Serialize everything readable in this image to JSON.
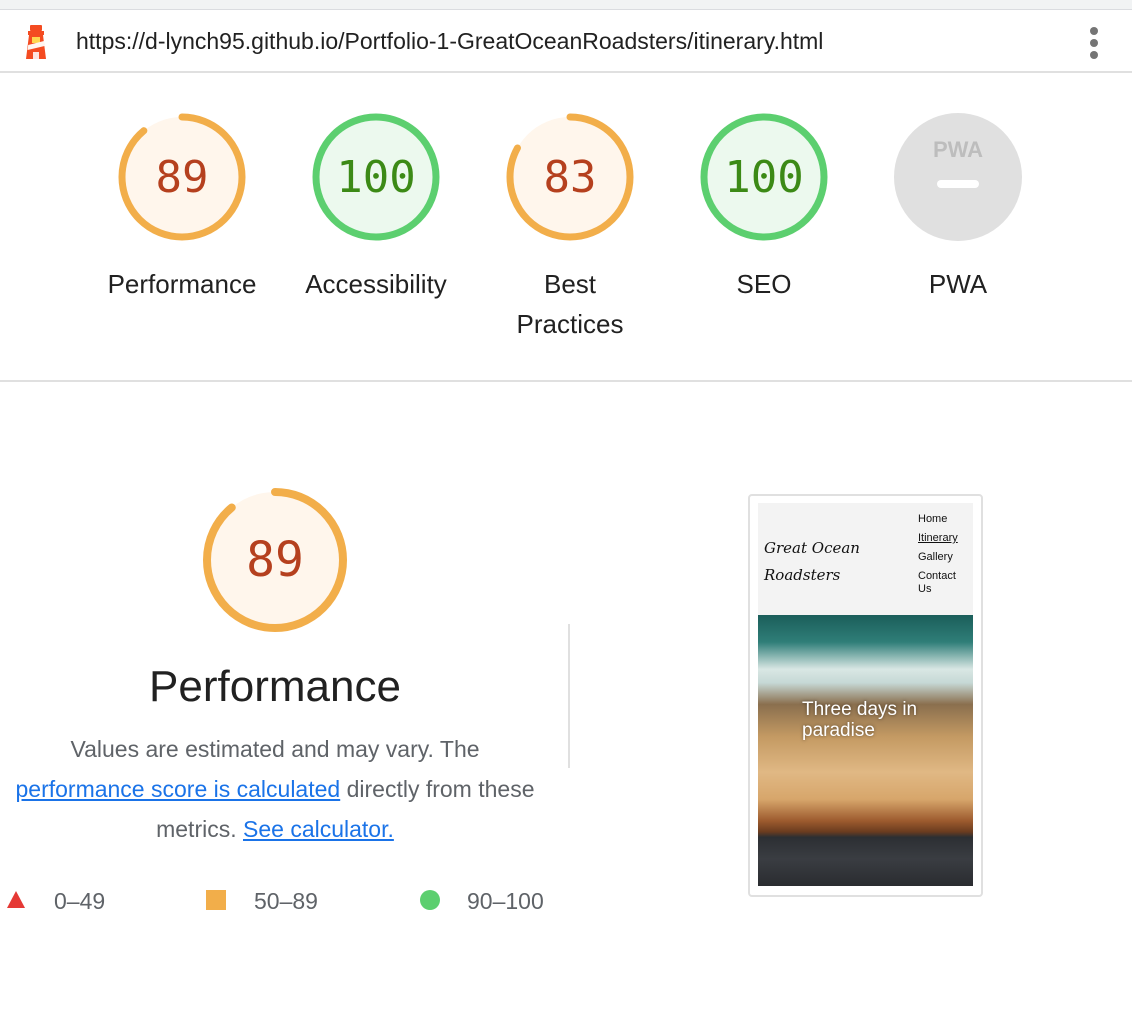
{
  "browser": {
    "url": "https://d-lynch95.github.io/Portfolio-1-GreatOceanRoadsters/itinerary.html",
    "logo_icon": "lighthouse-icon",
    "menu_icon": "kebab-menu-icon"
  },
  "colors": {
    "average_stroke": "#f2ae4a",
    "average_fill": "#fff6ec",
    "average_text": "#b5401e",
    "pass_stroke": "#5ccf6f",
    "pass_fill": "#ecf9ee",
    "pass_text": "#3c8a16",
    "fail": "#e53935",
    "na_fill": "#e0e0e0",
    "link": "#1a73e8"
  },
  "categories": [
    {
      "score": "89",
      "label": "Performance",
      "rating": "average",
      "fraction": 0.89
    },
    {
      "score": "100",
      "label": "Accessibility",
      "rating": "pass",
      "fraction": 1.0
    },
    {
      "score": "83",
      "label": "Best Practices",
      "rating": "average",
      "fraction": 0.83
    },
    {
      "score": "100",
      "label": "SEO",
      "rating": "pass",
      "fraction": 1.0
    },
    {
      "score": "",
      "label": "PWA",
      "rating": "na",
      "badge": "PWA"
    }
  ],
  "performance": {
    "score": "89",
    "fraction": 0.89,
    "title": "Performance",
    "desc_prefix": "Values are estimated and may vary. The ",
    "link1": "performance score is calculated",
    "desc_mid": " directly from these metrics. ",
    "link2": "See calculator."
  },
  "legend": [
    {
      "range": "0–49",
      "icon": "red-triangle-icon"
    },
    {
      "range": "50–89",
      "icon": "orange-square-icon"
    },
    {
      "range": "90–100",
      "icon": "green-circle-icon"
    }
  ],
  "screenshot": {
    "brand_line1": "Great Ocean",
    "brand_line2": "Roadsters",
    "nav": [
      "Home",
      "Itinerary",
      "Gallery",
      "Contact Us"
    ],
    "hero_text": "Three days in paradise"
  }
}
